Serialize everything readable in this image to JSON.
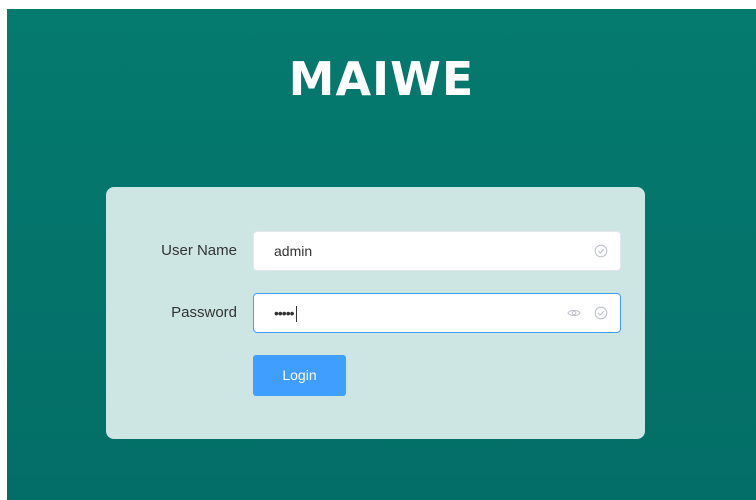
{
  "brand": {
    "logo_text": "MAIWE"
  },
  "login_form": {
    "username_label": "User Name",
    "username_value": "admin",
    "password_label": "Password",
    "password_masked": "•••••",
    "login_button_label": "Login"
  },
  "colors": {
    "background": "#057a6f",
    "card": "#cde6e4",
    "accent": "#409eff"
  },
  "icons": {
    "username_status": "circle-check-icon",
    "password_toggle": "eye-icon",
    "password_status": "circle-check-icon"
  }
}
